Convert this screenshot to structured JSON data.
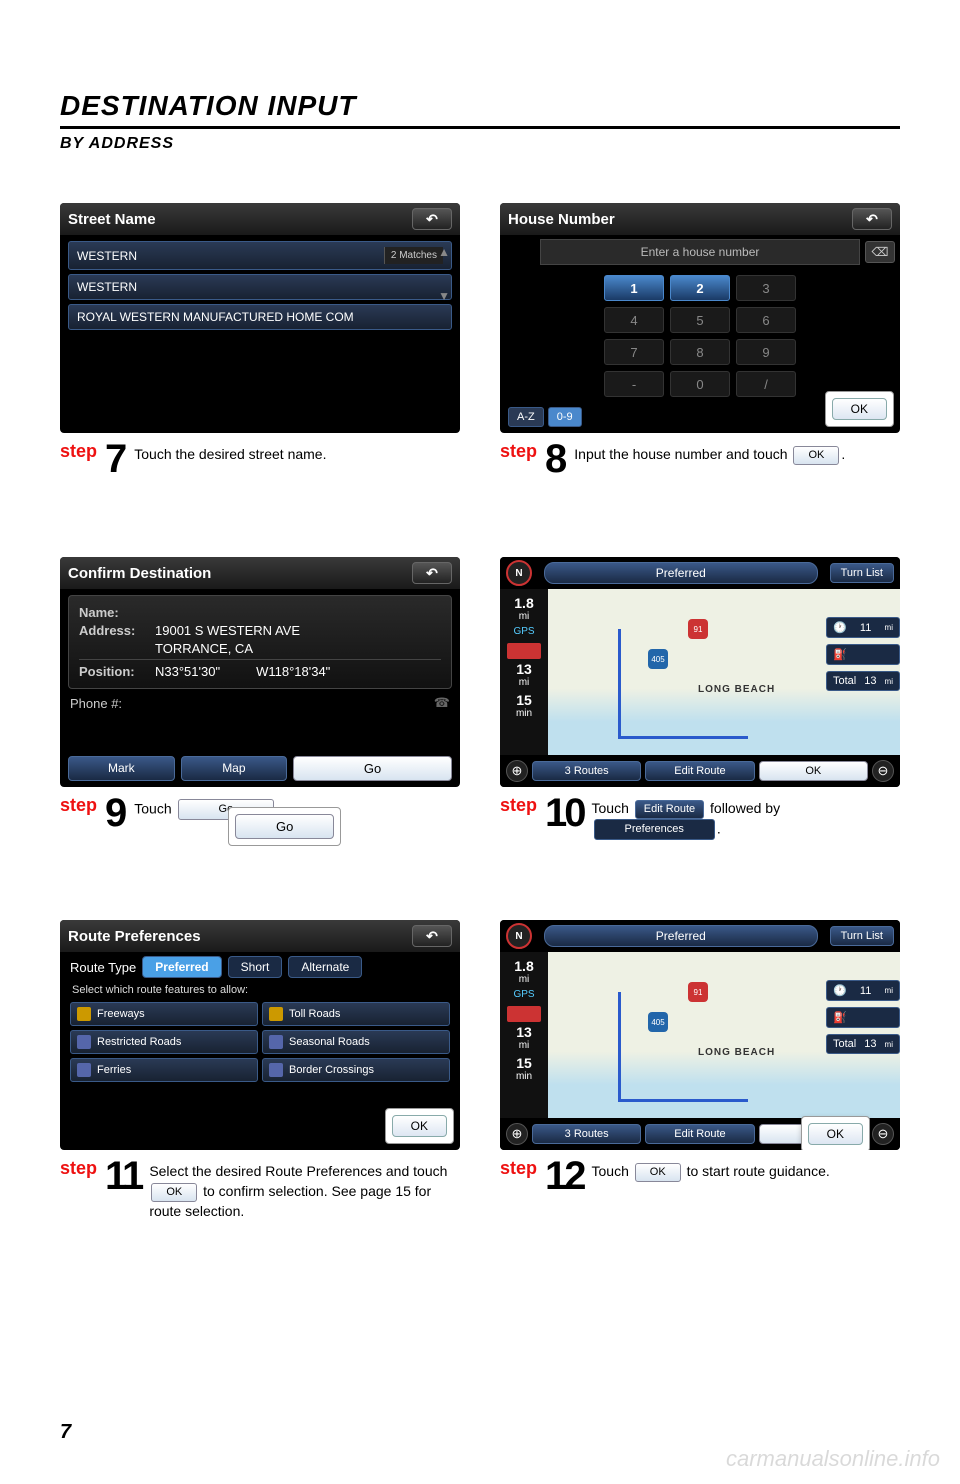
{
  "heading": "DESTINATION INPUT",
  "subheading": "BY ADDRESS",
  "page_number": "7",
  "watermark": "carmanualsonline.info",
  "step_label": "step",
  "s7": {
    "num": "7",
    "title": "Street Name",
    "matches": "2 Matches",
    "items": [
      "WESTERN",
      "WESTERN",
      "ROYAL WESTERN MANUFACTURED HOME COM"
    ],
    "caption": "Touch the desired street name."
  },
  "s8": {
    "num": "8",
    "title": "House Number",
    "placeholder": "Enter a house number",
    "keys": [
      "1",
      "2",
      "3",
      "4",
      "5",
      "6",
      "7",
      "8",
      "9",
      "-",
      "0",
      "/"
    ],
    "tab_az": "A-Z",
    "tab_09": "0-9",
    "ok": "OK",
    "caption_a": "Input the house number and touch",
    "caption_b": "."
  },
  "s9": {
    "num": "9",
    "title": "Confirm Destination",
    "name_label": "Name:",
    "addr_label": "Address:",
    "addr_1": "19001 S WESTERN AVE",
    "addr_2": "TORRANCE, CA",
    "pos_label": "Position:",
    "pos_1": "N33°51'30\"",
    "pos_2": "W118°18'34\"",
    "phone_label": "Phone #:",
    "btn_mark": "Mark",
    "btn_map": "Map",
    "btn_go": "Go",
    "caption_a": "Touch",
    "caption_b": "."
  },
  "s10": {
    "num": "10",
    "preferred": "Preferred",
    "turnlist": "Turn List",
    "stats": {
      "d": "1.8",
      "du": "mi",
      "g": "GPS",
      "eta": "13",
      "etau": "mi",
      "time": "15",
      "timeu": "min"
    },
    "side": {
      "v11": "11",
      "v11u": "mi",
      "total": "Total",
      "tval": "13",
      "tvalu": "mi"
    },
    "label_lb": "LONG BEACH",
    "btn_3routes": "3 Routes",
    "btn_edit": "Edit Route",
    "btn_ok": "OK",
    "caption_a": "Touch",
    "caption_b": "followed by",
    "caption_c": ".",
    "inline_edit": "Edit Route",
    "inline_pref": "Preferences"
  },
  "s11": {
    "num": "11",
    "title": "Route Preferences",
    "route_type": "Route Type",
    "opt_pref": "Preferred",
    "opt_short": "Short",
    "opt_alt": "Alternate",
    "select_text": "Select which route features to allow:",
    "features": [
      "Freeways",
      "Toll Roads",
      "Restricted Roads",
      "Seasonal Roads",
      "Ferries",
      "Border Crossings"
    ],
    "ok": "OK",
    "caption_a": "Select the desired Route Preferences and touch",
    "caption_b": "to confirm selection. See page 15 for route selection."
  },
  "s12": {
    "num": "12",
    "preferred": "Preferred",
    "turnlist": "Turn List",
    "label_lb": "LONG BEACH",
    "btn_3routes": "3 Routes",
    "btn_edit": "Edit Route",
    "btn_ok": "OK",
    "caption_a": "Touch",
    "caption_b": "to start route guidance."
  }
}
